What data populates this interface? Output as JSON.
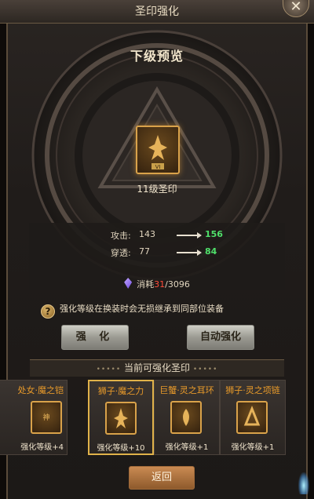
{
  "window": {
    "title": "圣印强化"
  },
  "preview": {
    "title": "下级预览",
    "seal_name": "11级圣印",
    "seal_badge": "VI"
  },
  "stats": [
    {
      "label": "攻击:",
      "current": "143",
      "next": "156"
    },
    {
      "label": "穿透:",
      "current": "77",
      "next": "84"
    }
  ],
  "cost": {
    "label": "消耗",
    "have": "31",
    "sep": "/",
    "need": "3096"
  },
  "hint": {
    "icon": "?",
    "text": "强化等级在换装时会无损继承到同部位装备"
  },
  "buttons": {
    "enhance": "强 化",
    "auto_enhance": "自动强化",
    "back": "返回"
  },
  "list": {
    "header": "当前可强化圣印",
    "items": [
      {
        "name": "处女·魔之铠",
        "level": "强化等级+4",
        "selected": false
      },
      {
        "name": "狮子·魔之力",
        "level": "强化等级+10",
        "selected": true
      },
      {
        "name": "巨蟹·灵之耳环",
        "level": "强化等级+1",
        "selected": false
      },
      {
        "name": "狮子·灵之项链",
        "level": "强化等级+1",
        "selected": false
      }
    ]
  },
  "colors": {
    "stat_up": "#4fe06a",
    "cost_have": "#ff4d3a",
    "item_name": "#e89a2a",
    "selected_border": "#e0b24a"
  }
}
